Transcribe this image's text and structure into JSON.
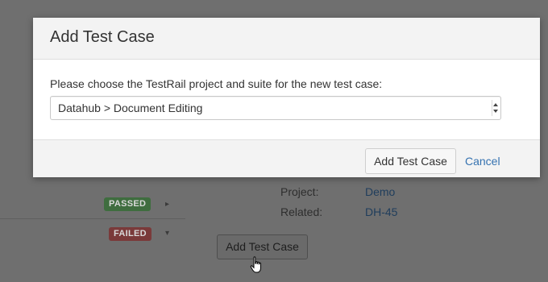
{
  "dialog": {
    "title": "Add Test Case",
    "prompt": "Please choose the TestRail project and suite for the new test case:",
    "select": {
      "selected": "Datahub > Document Editing"
    },
    "primary_button": "Add Test Case",
    "cancel_link": "Cancel"
  },
  "background": {
    "rows": [
      {
        "status": "PASSED",
        "caret": "right"
      },
      {
        "status": "FAILED",
        "caret": "down"
      }
    ],
    "details": [
      {
        "label": "Project:",
        "value": "Demo"
      },
      {
        "label": "Related:",
        "value": "DH-45"
      }
    ],
    "button": "Add Test Case"
  },
  "colors": {
    "overlay": "#6f6f6f",
    "link": "#3572b0",
    "passed": "#3f6d3f",
    "failed": "#7a3a3a"
  },
  "icons": {
    "row_caret_right": "caret-right-icon",
    "row_caret_down": "caret-down-icon",
    "select_arrow": "select-updown-icon",
    "cursor": "hand-pointer-cursor-icon"
  }
}
